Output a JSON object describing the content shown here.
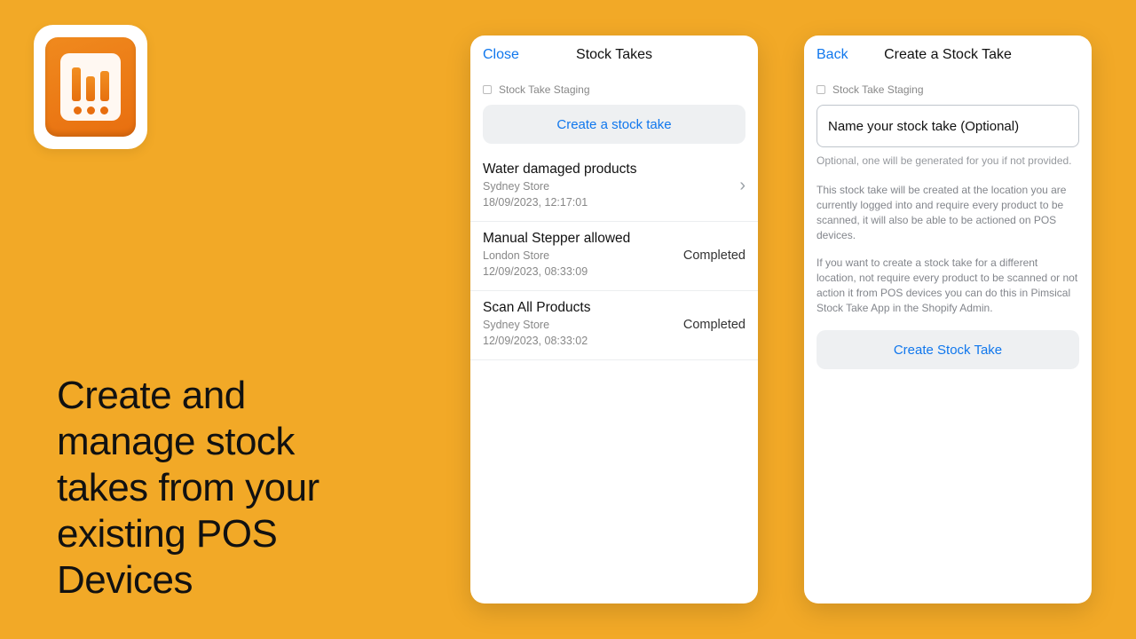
{
  "headline": "Create and manage stock takes from your existing POS Devices",
  "left_panel": {
    "nav_left": "Close",
    "nav_title": "Stock Takes",
    "subheader": "Stock Take Staging",
    "create_button": "Create a stock take",
    "items": [
      {
        "title": "Water damaged products",
        "store": "Sydney Store",
        "ts": "18/09/2023, 12:17:01",
        "status": "",
        "chevron": true
      },
      {
        "title": "Manual Stepper allowed",
        "store": "London Store",
        "ts": "12/09/2023, 08:33:09",
        "status": "Completed",
        "chevron": false
      },
      {
        "title": "Scan All Products",
        "store": "Sydney Store",
        "ts": "12/09/2023, 08:33:02",
        "status": "Completed",
        "chevron": false
      }
    ]
  },
  "right_panel": {
    "nav_left": "Back",
    "nav_title": "Create a Stock Take",
    "subheader": "Stock Take Staging",
    "name_placeholder": "Name your stock take (Optional)",
    "hint": "Optional, one will be generated for you if not provided.",
    "para1": "This stock take will be created at the location you are currently logged into and require every product to be scanned, it will also be able to be actioned on POS devices.",
    "para2": "If you want to create a stock take for a different location, not require every product to be scanned or not action it from POS devices you can do this in Pimsical Stock Take App in the Shopify Admin.",
    "create_button": "Create Stock Take"
  }
}
